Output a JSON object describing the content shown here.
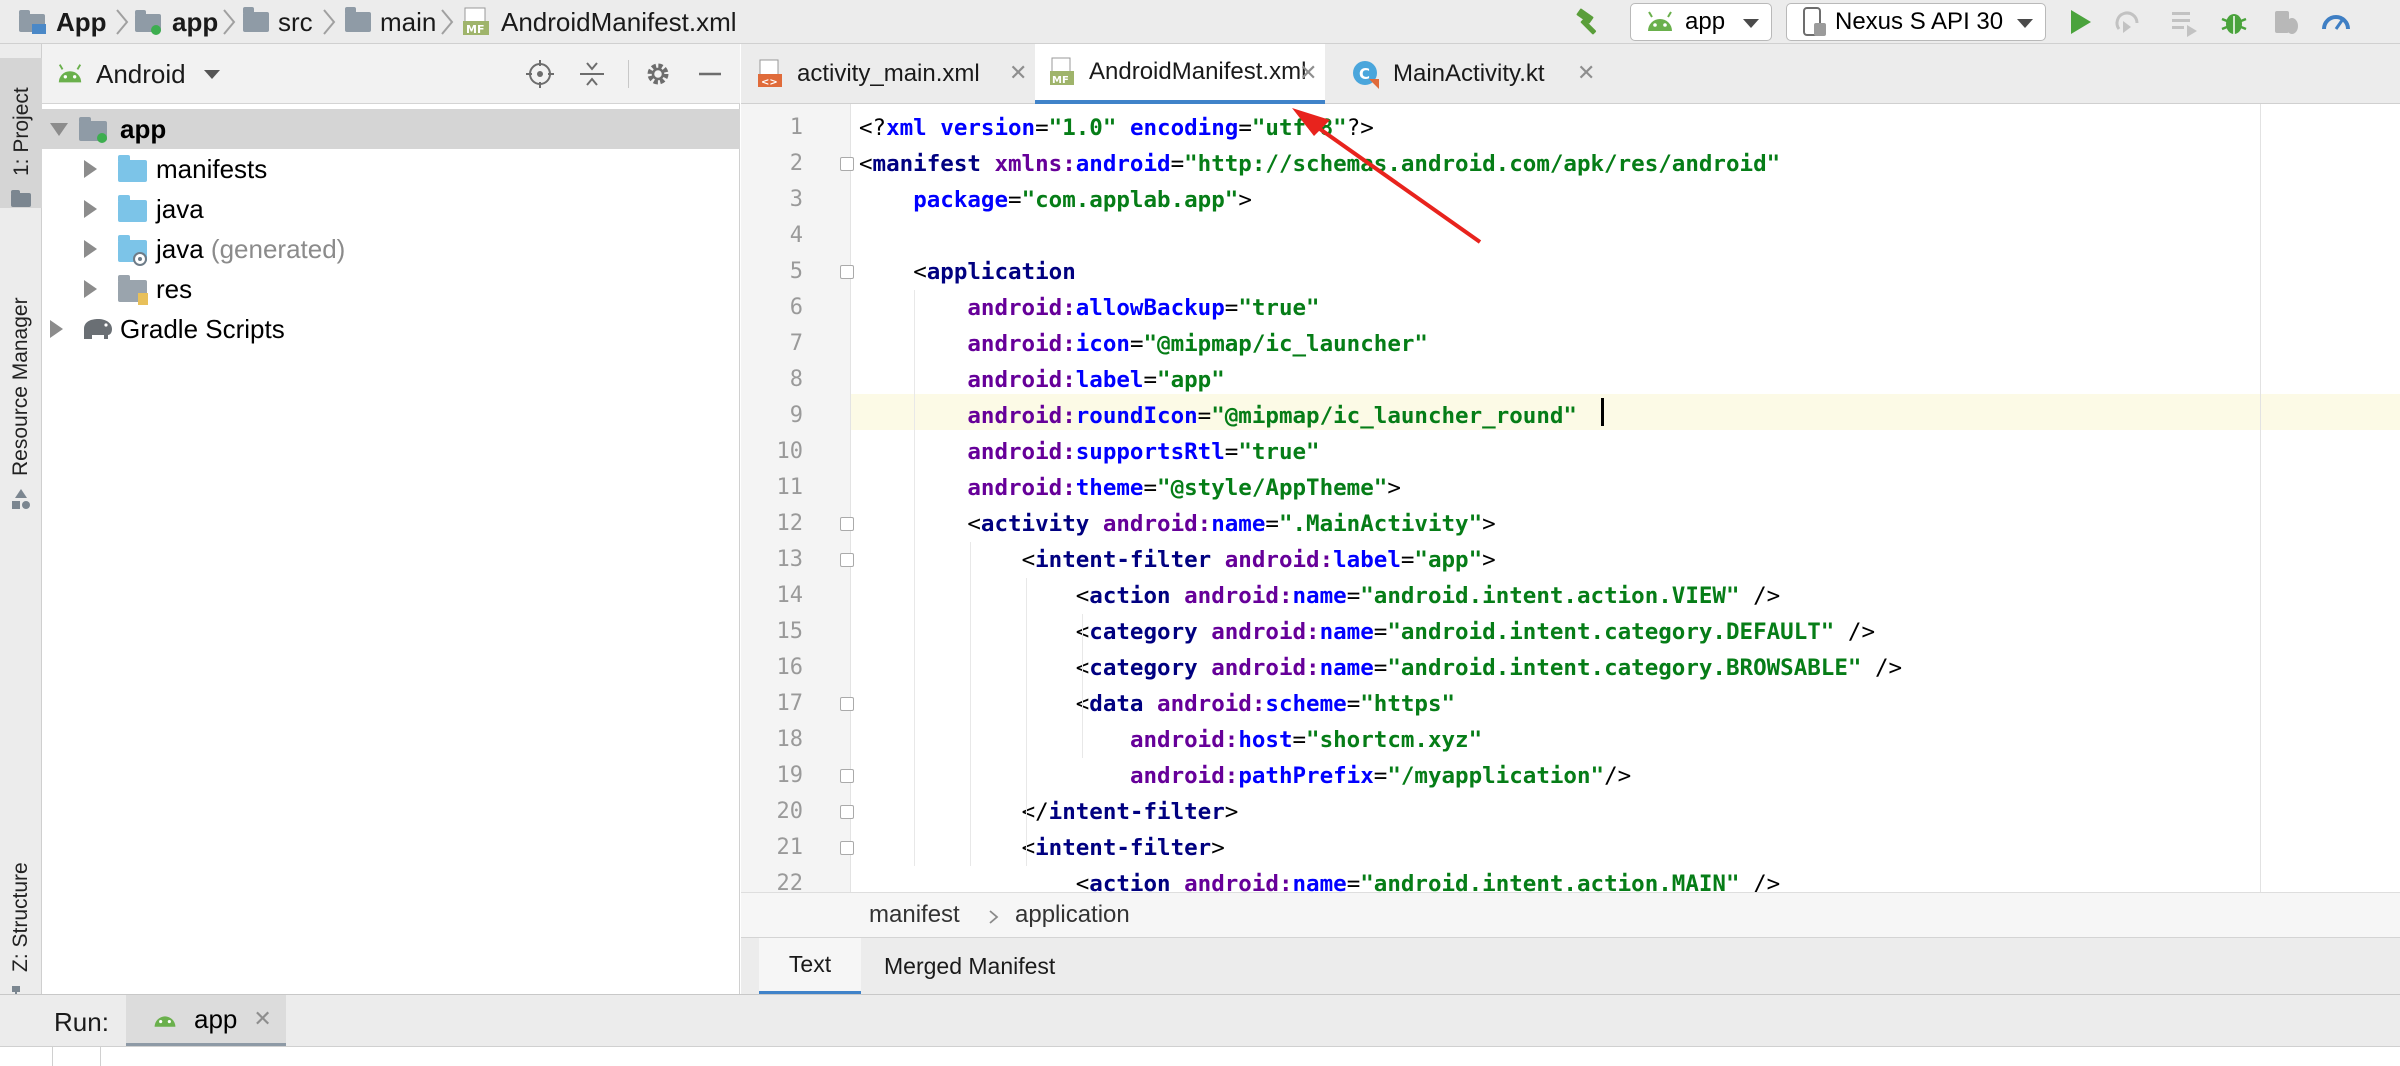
{
  "breadcrumbs": [
    "App",
    "app",
    "src",
    "main",
    "AndroidManifest.xml"
  ],
  "run_config": {
    "module": "app",
    "device": "Nexus S API 30"
  },
  "left_strip": {
    "project_tab": "1: Project",
    "resource_tab": "Resource Manager",
    "structure_tab": "Z: Structure"
  },
  "project_panel": {
    "view_label": "Android",
    "tree": [
      {
        "label": "app",
        "generated": ""
      },
      {
        "label": "manifests",
        "generated": ""
      },
      {
        "label": "java",
        "generated": ""
      },
      {
        "label": "java",
        "generated": " (generated)"
      },
      {
        "label": "res",
        "generated": ""
      },
      {
        "label": "Gradle Scripts",
        "generated": ""
      }
    ]
  },
  "editor_tabs": [
    "activity_main.xml",
    "AndroidManifest.xml",
    "MainActivity.kt"
  ],
  "code_lines": [
    "<?xml version=\"1.0\" encoding=\"utf-8\"?>",
    "<manifest xmlns:android=\"http://schemas.android.com/apk/res/android\"",
    "    package=\"com.applab.app\">",
    "",
    "    <application",
    "        android:allowBackup=\"true\"",
    "        android:icon=\"@mipmap/ic_launcher\"",
    "        android:label=\"app\"",
    "        android:roundIcon=\"@mipmap/ic_launcher_round\"",
    "        android:supportsRtl=\"true\"",
    "        android:theme=\"@style/AppTheme\">",
    "        <activity android:name=\".MainActivity\">",
    "            <intent-filter android:label=\"app\">",
    "                <action android:name=\"android.intent.action.VIEW\" />",
    "                <category android:name=\"android.intent.category.DEFAULT\" />",
    "                <category android:name=\"android.intent.category.BROWSABLE\" />",
    "                <data android:scheme=\"https\"",
    "                    android:host=\"shortcm.xyz\"",
    "                    android:pathPrefix=\"/myapplication\"/>",
    "            </intent-filter>",
    "            <intent-filter>",
    "                <action android:name=\"android.intent.action.MAIN\" />"
  ],
  "line_numbers": [
    "1",
    "2",
    "3",
    "4",
    "5",
    "6",
    "7",
    "8",
    "9",
    "10",
    "11",
    "12",
    "13",
    "14",
    "15",
    "16",
    "17",
    "18",
    "19",
    "20",
    "21",
    "22"
  ],
  "editor_breadcrumb": [
    "manifest",
    "application"
  ],
  "bottom_tabs": [
    "Text",
    "Merged Manifest"
  ],
  "run_panel": {
    "label": "Run:",
    "tab": "app"
  },
  "colors": {
    "accent": "#4083c9",
    "android_green": "#6ab04c",
    "annotation_arrow": "#e8231d"
  }
}
